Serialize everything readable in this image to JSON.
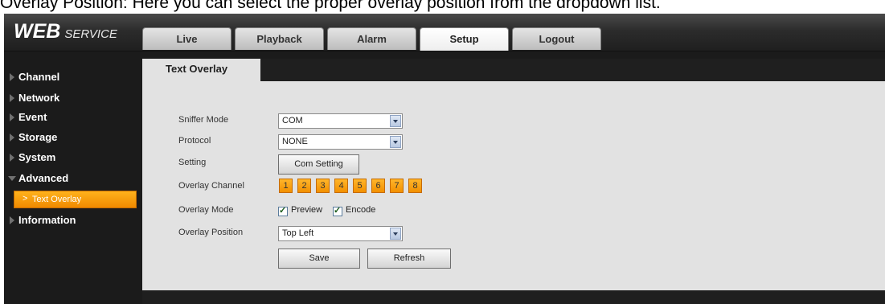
{
  "caption": "Overlay Position: Here you can select the proper overlay position from the dropdown list.",
  "logo": {
    "main": "WEB",
    "sub": "SERVICE"
  },
  "tabs": [
    {
      "label": "Live"
    },
    {
      "label": "Playback"
    },
    {
      "label": "Alarm"
    },
    {
      "label": "Setup",
      "active": true
    },
    {
      "label": "Logout"
    }
  ],
  "sidebar": {
    "items": [
      {
        "label": "Channel"
      },
      {
        "label": "Network"
      },
      {
        "label": "Event"
      },
      {
        "label": "Storage"
      },
      {
        "label": "System"
      },
      {
        "label": "Advanced",
        "expanded": true
      },
      {
        "label": "Information"
      }
    ],
    "sub_item": {
      "label": "Text Overlay"
    }
  },
  "content": {
    "tab_title": "Text Overlay",
    "sniffer_mode": {
      "label": "Sniffer Mode",
      "value": "COM"
    },
    "protocol": {
      "label": "Protocol",
      "value": "NONE"
    },
    "setting": {
      "label": "Setting",
      "button": "Com Setting"
    },
    "overlay_channel": {
      "label": "Overlay Channel",
      "channels": [
        "1",
        "2",
        "3",
        "4",
        "5",
        "6",
        "7",
        "8"
      ]
    },
    "overlay_mode": {
      "label": "Overlay Mode",
      "preview": "Preview",
      "encode": "Encode",
      "preview_checked": true,
      "encode_checked": true
    },
    "overlay_position": {
      "label": "Overlay Position",
      "value": "Top Left"
    },
    "save": "Save",
    "refresh": "Refresh"
  },
  "colors": {
    "accent": "#f29000",
    "background": "#1b1b1b",
    "panel": "#e2e2e2"
  }
}
